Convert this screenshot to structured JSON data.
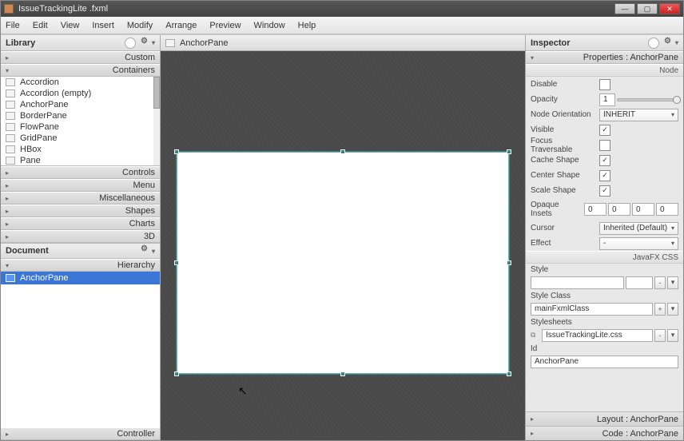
{
  "window": {
    "title": "IssueTrackingLite .fxml"
  },
  "menu": {
    "items": [
      "File",
      "Edit",
      "View",
      "Insert",
      "Modify",
      "Arrange",
      "Preview",
      "Window",
      "Help"
    ]
  },
  "library": {
    "title": "Library",
    "custom": "Custom",
    "containers": "Containers",
    "items": [
      "Accordion",
      "Accordion  (empty)",
      "AnchorPane",
      "BorderPane",
      "FlowPane",
      "GridPane",
      "HBox",
      "Pane"
    ],
    "sections": [
      "Controls",
      "Menu",
      "Miscellaneous",
      "Shapes",
      "Charts",
      "3D"
    ]
  },
  "document": {
    "title": "Document",
    "hierarchy": "Hierarchy",
    "selected": "AnchorPane",
    "controller": "Controller"
  },
  "content": {
    "tab": "AnchorPane"
  },
  "inspector": {
    "title": "Inspector",
    "propsHeader": "Properties : AnchorPane",
    "nodeHeader": "Node",
    "disable": {
      "label": "Disable",
      "checked": false
    },
    "opacity": {
      "label": "Opacity",
      "value": "1"
    },
    "nodeOrientation": {
      "label": "Node Orientation",
      "value": "INHERIT"
    },
    "visible": {
      "label": "Visible",
      "checked": true
    },
    "focusTraversable": {
      "label": "Focus Traversable",
      "checked": false
    },
    "cacheShape": {
      "label": "Cache Shape",
      "checked": true
    },
    "centerShape": {
      "label": "Center Shape",
      "checked": true
    },
    "scaleShape": {
      "label": "Scale Shape",
      "checked": true
    },
    "opaqueInsets": {
      "label": "Opaque Insets",
      "values": [
        "0",
        "0",
        "0",
        "0"
      ]
    },
    "cursor": {
      "label": "Cursor",
      "value": "Inherited (Default)"
    },
    "effect": {
      "label": "Effect",
      "value": "-"
    },
    "cssHeader": "JavaFX CSS",
    "style": {
      "label": "Style"
    },
    "styleClass": {
      "label": "Style Class",
      "value": "mainFxmlClass"
    },
    "stylesheets": {
      "label": "Stylesheets",
      "value": "IssueTrackingLite.css"
    },
    "id": {
      "label": "Id",
      "value": "AnchorPane"
    },
    "layoutFooter": "Layout : AnchorPane",
    "codeFooter": "Code : AnchorPane"
  }
}
